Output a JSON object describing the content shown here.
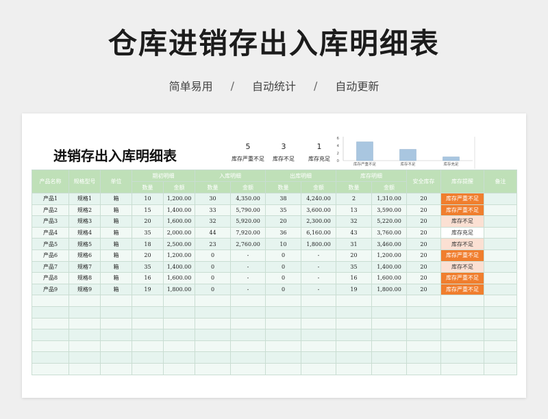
{
  "hero": {
    "title": "仓库进销存出入库明细表",
    "tags": [
      "简单易用",
      "自动统计",
      "自动更新"
    ],
    "separator": "/"
  },
  "sheet": {
    "title": "进销存出入库明细表",
    "summary": [
      {
        "count": "5",
        "label": "库存严重不足"
      },
      {
        "count": "3",
        "label": "库存不足"
      },
      {
        "count": "1",
        "label": "库存充足"
      }
    ]
  },
  "chart_data": {
    "type": "bar",
    "categories": [
      "库存严重不足",
      "库存不足",
      "库存充足"
    ],
    "values": [
      5,
      3,
      1
    ],
    "yticks": [
      "0",
      "2",
      "4",
      "6"
    ],
    "ylim": [
      0,
      6
    ],
    "bar_color": "#a9c6e0"
  },
  "table": {
    "headers": {
      "product_name": "产品名称",
      "model": "规格型号",
      "unit": "单位",
      "group_opening": "期初明细",
      "group_in": "入库明细",
      "group_out": "出库明细",
      "group_stock": "库存明细",
      "qty": "数量",
      "amount": "金额",
      "safety_stock": "安全库存",
      "alert": "库存提醒",
      "remark": "备注"
    },
    "rows": [
      {
        "name": "产品1",
        "model": "规格1",
        "unit": "箱",
        "open_qty": "10",
        "open_amt": "1,200.00",
        "in_qty": "30",
        "in_amt": "4,350.00",
        "out_qty": "38",
        "out_amt": "4,240.00",
        "stk_qty": "2",
        "stk_amt": "1,310.00",
        "safety": "20",
        "alert": "库存严重不足",
        "level": "severe"
      },
      {
        "name": "产品2",
        "model": "规格2",
        "unit": "箱",
        "open_qty": "15",
        "open_amt": "1,400.00",
        "in_qty": "33",
        "in_amt": "5,790.00",
        "out_qty": "35",
        "out_amt": "3,600.00",
        "stk_qty": "13",
        "stk_amt": "3,590.00",
        "safety": "20",
        "alert": "库存严重不足",
        "level": "severe"
      },
      {
        "name": "产品3",
        "model": "规格3",
        "unit": "箱",
        "open_qty": "20",
        "open_amt": "1,600.00",
        "in_qty": "32",
        "in_amt": "5,920.00",
        "out_qty": "20",
        "out_amt": "2,300.00",
        "stk_qty": "32",
        "stk_amt": "5,220.00",
        "safety": "20",
        "alert": "库存不足",
        "level": "low"
      },
      {
        "name": "产品4",
        "model": "规格4",
        "unit": "箱",
        "open_qty": "35",
        "open_amt": "2,000.00",
        "in_qty": "44",
        "in_amt": "7,920.00",
        "out_qty": "36",
        "out_amt": "6,160.00",
        "stk_qty": "43",
        "stk_amt": "3,760.00",
        "safety": "20",
        "alert": "库存充足",
        "level": "ok"
      },
      {
        "name": "产品5",
        "model": "规格5",
        "unit": "箱",
        "open_qty": "18",
        "open_amt": "2,500.00",
        "in_qty": "23",
        "in_amt": "2,760.00",
        "out_qty": "10",
        "out_amt": "1,800.00",
        "stk_qty": "31",
        "stk_amt": "3,460.00",
        "safety": "20",
        "alert": "库存不足",
        "level": "low"
      },
      {
        "name": "产品6",
        "model": "规格6",
        "unit": "箱",
        "open_qty": "20",
        "open_amt": "1,200.00",
        "in_qty": "0",
        "in_amt": "-",
        "out_qty": "0",
        "out_amt": "-",
        "stk_qty": "20",
        "stk_amt": "1,200.00",
        "safety": "20",
        "alert": "库存严重不足",
        "level": "severe"
      },
      {
        "name": "产品7",
        "model": "规格7",
        "unit": "箱",
        "open_qty": "35",
        "open_amt": "1,400.00",
        "in_qty": "0",
        "in_amt": "-",
        "out_qty": "0",
        "out_amt": "-",
        "stk_qty": "35",
        "stk_amt": "1,400.00",
        "safety": "20",
        "alert": "库存不足",
        "level": "low"
      },
      {
        "name": "产品8",
        "model": "规格8",
        "unit": "箱",
        "open_qty": "16",
        "open_amt": "1,600.00",
        "in_qty": "0",
        "in_amt": "-",
        "out_qty": "0",
        "out_amt": "-",
        "stk_qty": "16",
        "stk_amt": "1,600.00",
        "safety": "20",
        "alert": "库存严重不足",
        "level": "severe"
      },
      {
        "name": "产品9",
        "model": "规格9",
        "unit": "箱",
        "open_qty": "19",
        "open_amt": "1,800.00",
        "in_qty": "0",
        "in_amt": "-",
        "out_qty": "0",
        "out_amt": "-",
        "stk_qty": "19",
        "stk_amt": "1,800.00",
        "safety": "20",
        "alert": "库存严重不足",
        "level": "severe"
      }
    ],
    "empty_rows": 7
  }
}
